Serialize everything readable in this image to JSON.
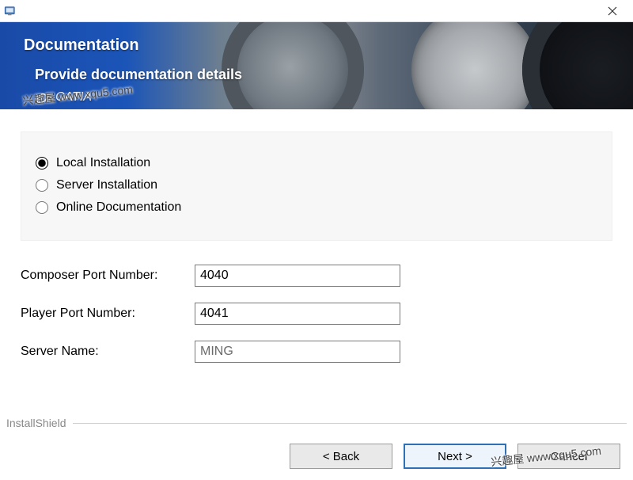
{
  "titlebar": {
    "title": ""
  },
  "banner": {
    "title": "Documentation",
    "subtitle": "Provide documentation details",
    "brand": "CATIA"
  },
  "options": {
    "local": "Local Installation",
    "server": "Server Installation",
    "online": "Online Documentation",
    "selected": "local"
  },
  "fields": {
    "composer_port": {
      "label": "Composer Port Number:",
      "value": "4040"
    },
    "player_port": {
      "label": "Player Port Number:",
      "value": "4041"
    },
    "server_name": {
      "label": "Server Name:",
      "value": "MING"
    }
  },
  "footer": {
    "brand": "InstallShield",
    "back": "< Back",
    "next": "Next >",
    "cancel": "Cancel"
  },
  "watermark": "兴趣屋 www.xqu5.com"
}
